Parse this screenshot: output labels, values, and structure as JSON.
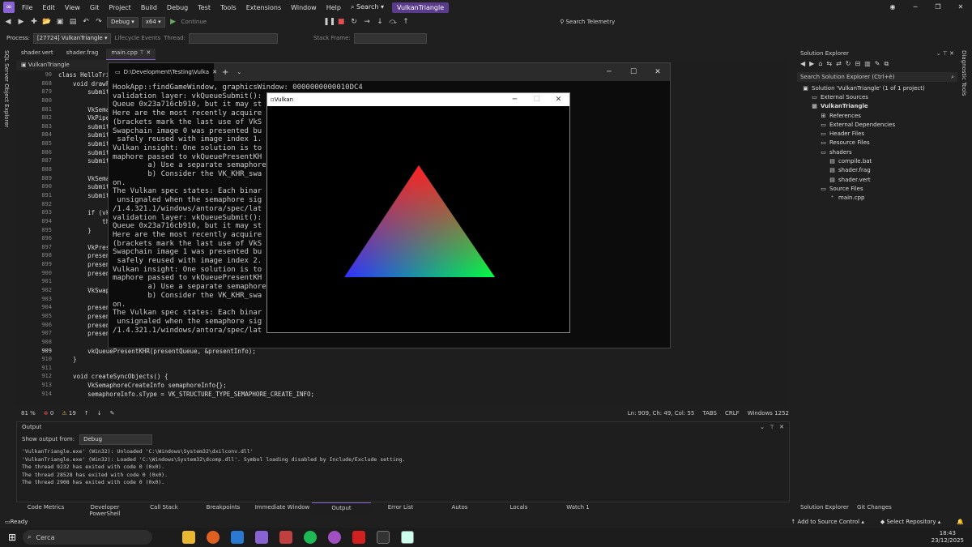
{
  "menubar": {
    "items": [
      "File",
      "Edit",
      "View",
      "Git",
      "Project",
      "Build",
      "Debug",
      "Test",
      "Tools",
      "Extensions",
      "Window",
      "Help"
    ],
    "search_label": "Search",
    "solution_badge": "VulkanTriangle"
  },
  "toolbar": {
    "config": "Debug",
    "platform": "x64",
    "continue_label": "Continue",
    "search_telemetry": "Search Telemetry"
  },
  "toolbar2": {
    "process_label": "Process:",
    "process_value": "[27724] VulkanTriangle",
    "lifecycle_label": "Lifecycle Events",
    "thread_label": "Thread:",
    "stackframe_label": "Stack Frame:"
  },
  "left_sidebar": {
    "label": "SQL Server Object Explorer"
  },
  "right_sidebar": {
    "label": "Diagnostic Tools"
  },
  "doc_tabs": [
    "shader.vert",
    "shader.frag",
    "main.cpp"
  ],
  "editor": {
    "file_header": "VulkanTriangle",
    "lines": [
      {
        "n": "90",
        "t": "class HelloTri"
      },
      {
        "n": "868",
        "t": "    void drawF"
      },
      {
        "n": "879",
        "t": "        submit"
      },
      {
        "n": "880",
        "t": ""
      },
      {
        "n": "881",
        "t": "        VkSema"
      },
      {
        "n": "882",
        "t": "        VkPipe"
      },
      {
        "n": "883",
        "t": "        submit"
      },
      {
        "n": "884",
        "t": "        submit"
      },
      {
        "n": "885",
        "t": "        submit"
      },
      {
        "n": "886",
        "t": "        submit"
      },
      {
        "n": "887",
        "t": "        submit"
      },
      {
        "n": "888",
        "t": ""
      },
      {
        "n": "889",
        "t": "        VkSema"
      },
      {
        "n": "890",
        "t": "        submit"
      },
      {
        "n": "891",
        "t": "        submit"
      },
      {
        "n": "892",
        "t": ""
      },
      {
        "n": "893",
        "t": "        if (vk"
      },
      {
        "n": "894",
        "t": "            th"
      },
      {
        "n": "895",
        "t": "        }"
      },
      {
        "n": "896",
        "t": ""
      },
      {
        "n": "897",
        "t": "        VkPres"
      },
      {
        "n": "898",
        "t": "        presen"
      },
      {
        "n": "899",
        "t": "        presen"
      },
      {
        "n": "900",
        "t": "        presen"
      },
      {
        "n": "901",
        "t": ""
      },
      {
        "n": "902",
        "t": "        VkSwap"
      },
      {
        "n": "903",
        "t": ""
      },
      {
        "n": "904",
        "t": "        presen"
      },
      {
        "n": "905",
        "t": "        presen"
      },
      {
        "n": "906",
        "t": "        presen"
      },
      {
        "n": "907",
        "t": "        presen"
      },
      {
        "n": "908",
        "t": ""
      },
      {
        "n": "909",
        "t": "        vkQueuePresentKHR(presentQueue, &presentInfo);"
      },
      {
        "n": "910",
        "t": "    }"
      },
      {
        "n": "911",
        "t": ""
      },
      {
        "n": "912",
        "t": "    void createSyncObjects() {"
      },
      {
        "n": "913",
        "t": "        VkSemaphoreCreateInfo semaphoreInfo{};"
      },
      {
        "n": "914",
        "t": "        semaphoreInfo.sType = VK_STRUCTURE_TYPE_SEMAPHORE_CREATE_INFO;"
      }
    ]
  },
  "terminal": {
    "tab_title": "D:\\Development\\Testing\\Vulka",
    "lines": [
      "HookApp::findGameWindow, graphicsWindow: 0000000000010DC4",
      "validation layer: vkQueueSubmit():                           being signaled by Vk",
      "Queue 0x23a716cb910, but it may st",
      "Here are the most recently acquire",
      "(brackets mark the last use of VkS",
      "Swapchain image 0 was presented bu                           in use and cannot be",
      " safely reused with image index 1.",
      "Vulkan insight: One solution is to                           to ensure that a se",
      "maphore passed to vkQueuePresentKH",
      "        a) Use a separate semaphore                          he acquired image.",
      "        b) Consider the VK_KHR_swa                          resentation operati",
      "on.",
      "The Vulkan spec states: Each binar                          of pSubmits must be",
      " unsignaled when the semaphore sig                          lunarg.com/doc/view",
      "/1.4.321.1/windows/antora/spec/lat                          00067)",
      "validation layer: vkQueueSubmit():                           being signaled by Vk",
      "Queue 0x23a716cb910, but it may st",
      "Here are the most recently acquire",
      "(brackets mark the last use of VkS",
      "Swapchain image 1 was presented bu                           in use and cannot be",
      " safely reused with image index 2.",
      "Vulkan insight: One solution is to                           to ensure that a se",
      "maphore passed to vkQueuePresentKH",
      "        a) Use a separate semaphore                          he acquired image.",
      "        b) Consider the VK_KHR_swa                          resentation operati",
      "on.",
      "The Vulkan spec states: Each binar                          of pSubmits must be",
      " unsignaled when the semaphore sig                          lunarg.com/doc/view",
      "/1.4.321.1/windows/antora/spec/lat                          00067)"
    ]
  },
  "vulkan_window": {
    "title": "Vulkan"
  },
  "statusline": {
    "zoom": "81 %",
    "errors": "0",
    "warnings": "19",
    "position": "Ln: 909, Ch: 49, Col: 55",
    "tabs": "TABS",
    "eol": "CRLF",
    "encoding": "Windows 1252"
  },
  "output": {
    "title": "Output",
    "show_from_label": "Show output from:",
    "show_from_value": "Debug",
    "lines": [
      "'VulkanTriangle.exe' (Win32): Unloaded 'C:\\Windows\\System32\\dxilconv.dll'",
      "'VulkanTriangle.exe' (Win32): Loaded 'C:\\Windows\\System32\\dcomp.dll'. Symbol loading disabled by Include/Exclude setting.",
      "The thread 9232 has exited with code 0 (0x0).",
      "The thread 28528 has exited with code 0 (0x0).",
      "The thread 2908 has exited with code 0 (0x0)."
    ]
  },
  "bottom_tabs": [
    "Code Metrics",
    "Developer PowerShell",
    "Call Stack",
    "Breakpoints",
    "Immediate Window",
    "Output",
    "Error List",
    "Autos",
    "Locals",
    "Watch 1"
  ],
  "solution_explorer": {
    "title": "Solution Explorer",
    "search_placeholder": "Search Solution Explorer (Ctrl+è)",
    "tree": [
      {
        "indent": 0,
        "label": "Solution 'VulkanTriangle' (1 of 1 project)",
        "icon": "solution-icon"
      },
      {
        "indent": 1,
        "label": "External Sources",
        "icon": "folder-icon"
      },
      {
        "indent": 1,
        "label": "VulkanTriangle",
        "icon": "project-icon",
        "bold": true
      },
      {
        "indent": 2,
        "label": "References",
        "icon": "references-icon"
      },
      {
        "indent": 2,
        "label": "External Dependencies",
        "icon": "folder-icon"
      },
      {
        "indent": 2,
        "label": "Header Files",
        "icon": "folder-icon"
      },
      {
        "indent": 2,
        "label": "Resource Files",
        "icon": "folder-icon"
      },
      {
        "indent": 2,
        "label": "shaders",
        "icon": "folder-icon"
      },
      {
        "indent": 3,
        "label": "compile.bat",
        "icon": "file-icon"
      },
      {
        "indent": 3,
        "label": "shader.frag",
        "icon": "file-icon"
      },
      {
        "indent": 3,
        "label": "shader.vert",
        "icon": "file-icon"
      },
      {
        "indent": 2,
        "label": "Source Files",
        "icon": "folder-icon"
      },
      {
        "indent": 3,
        "label": "main.cpp",
        "icon": "cpp-file-icon"
      }
    ],
    "bottom_tabs": [
      "Solution Explorer",
      "Git Changes"
    ]
  },
  "status": {
    "ready": "Ready",
    "add_source_control": "Add to Source Control",
    "select_repo": "Select Repository"
  },
  "taskbar": {
    "search_placeholder": "Cerca",
    "time": "18:43",
    "date": "23/12/2025"
  }
}
